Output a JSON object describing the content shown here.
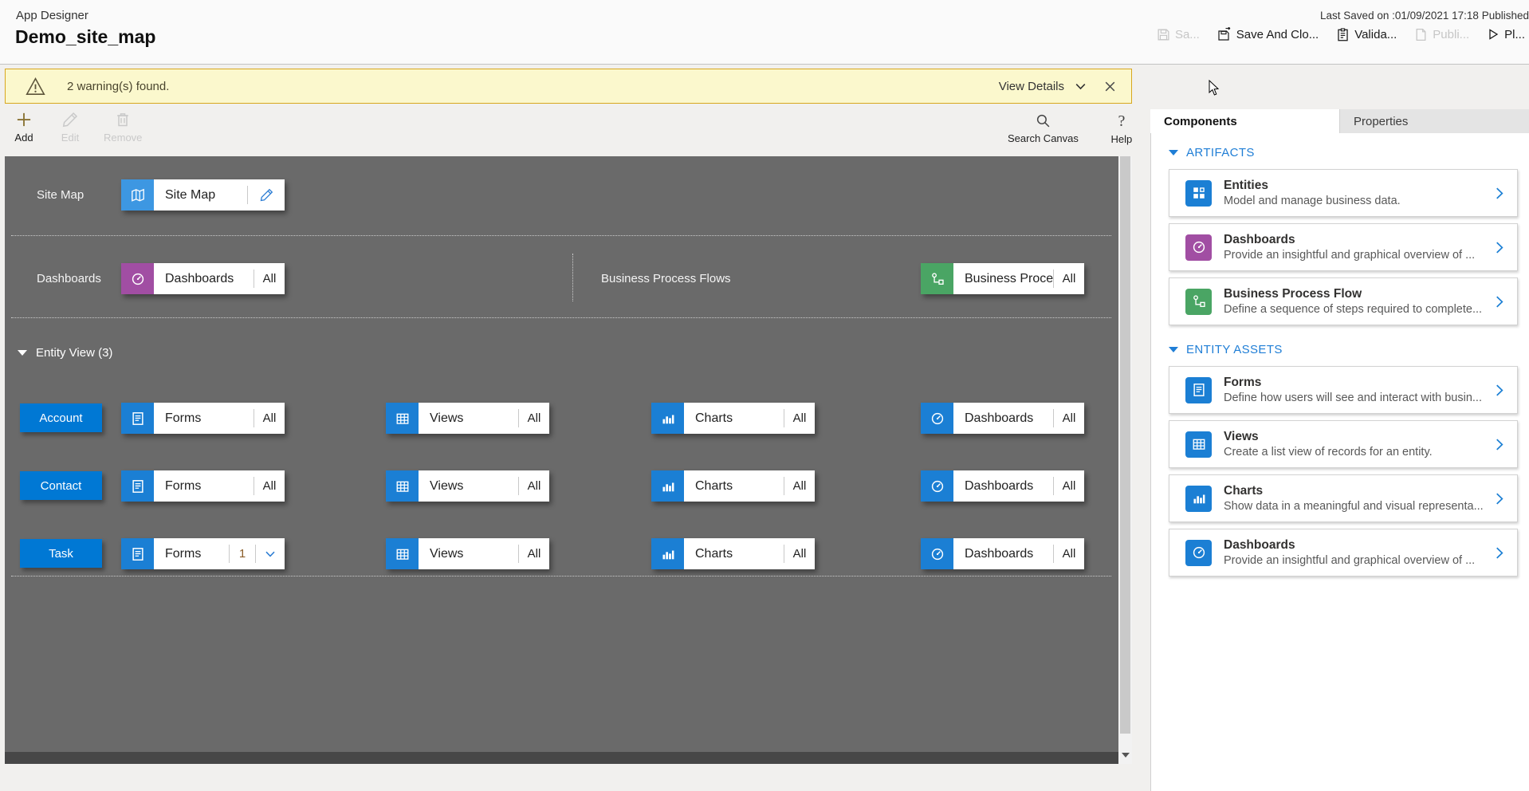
{
  "header": {
    "app_label": "App Designer",
    "title": "Demo_site_map",
    "status": "Last Saved on :01/09/2021 17:18 Published",
    "buttons": {
      "save": "Sa...",
      "save_and_close": "Save And Clo...",
      "validate": "Valida...",
      "publish": "Publi...",
      "play": "Pl..."
    }
  },
  "warning_banner": {
    "message": "2 warning(s) found.",
    "view_details": "View Details"
  },
  "command_bar": {
    "add": "Add",
    "edit": "Edit",
    "remove": "Remove",
    "search_canvas": "Search Canvas",
    "help": "Help"
  },
  "canvas": {
    "site_map": {
      "row_label": "Site Map",
      "tile_label": "Site Map"
    },
    "dashboards": {
      "row_label": "Dashboards",
      "tile_label": "Dashboards",
      "tile_value": "All"
    },
    "bpf": {
      "row_label": "Business Process Flows",
      "tile_label": "Business Proces...",
      "tile_value": "All"
    },
    "entity_view": {
      "header": "Entity View (3)",
      "rows": [
        {
          "entity": "Account",
          "tiles": [
            {
              "label": "Forms",
              "value": "All"
            },
            {
              "label": "Views",
              "value": "All"
            },
            {
              "label": "Charts",
              "value": "All"
            },
            {
              "label": "Dashboards",
              "value": "All"
            }
          ]
        },
        {
          "entity": "Contact",
          "tiles": [
            {
              "label": "Forms",
              "value": "All"
            },
            {
              "label": "Views",
              "value": "All"
            },
            {
              "label": "Charts",
              "value": "All"
            },
            {
              "label": "Dashboards",
              "value": "All"
            }
          ]
        },
        {
          "entity": "Task",
          "tiles": [
            {
              "label": "Forms",
              "value": "1",
              "has_dropdown": true
            },
            {
              "label": "Views",
              "value": "All"
            },
            {
              "label": "Charts",
              "value": "All"
            },
            {
              "label": "Dashboards",
              "value": "All"
            }
          ]
        }
      ]
    }
  },
  "right_panel": {
    "tabs": {
      "components": "Components",
      "properties": "Properties"
    },
    "artifacts": {
      "title": "ARTIFACTS",
      "cards": [
        {
          "title": "Entities",
          "desc": "Model and manage business data.",
          "icon": "entities-icon",
          "color": "#1b7fd4"
        },
        {
          "title": "Dashboards",
          "desc": "Provide an insightful and graphical overview of ...",
          "icon": "gauge-icon",
          "color": "#a14ea3"
        },
        {
          "title": "Business Process Flow",
          "desc": "Define a sequence of steps required to complete...",
          "icon": "flow-icon",
          "color": "#4aa564"
        }
      ]
    },
    "entity_assets": {
      "title": "ENTITY ASSETS",
      "cards": [
        {
          "title": "Forms",
          "desc": "Define how users will see and interact with busin...",
          "icon": "form-icon",
          "color": "#1b7fd4"
        },
        {
          "title": "Views",
          "desc": "Create a list view of records for an entity.",
          "icon": "table-icon",
          "color": "#1b7fd4"
        },
        {
          "title": "Charts",
          "desc": "Show data in a meaningful and visual representa...",
          "icon": "chart-icon",
          "color": "#1b7fd4"
        },
        {
          "title": "Dashboards",
          "desc": "Provide an insightful and graphical overview of ...",
          "icon": "gauge-icon",
          "color": "#1b7fd4"
        }
      ]
    }
  },
  "colors": {
    "accent_blue": "#1b7fd4",
    "entity_button_blue": "#0078d4",
    "sitemap_icon_blue": "#3d97e2",
    "dashboards_purple": "#a14ea3",
    "bpf_green": "#4aa564",
    "canvas_gray": "#6a6a6a",
    "banner_yellow": "#fbf8cd",
    "banner_border": "#d8a71f"
  }
}
